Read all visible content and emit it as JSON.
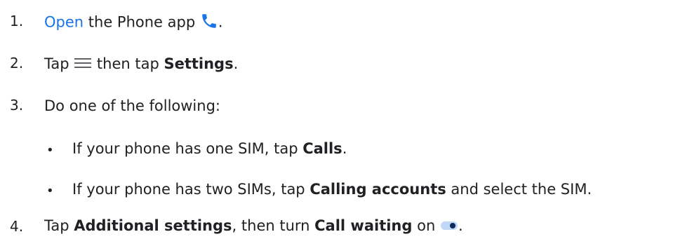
{
  "steps": [
    {
      "number": "1.",
      "link": "Open",
      "text_a": " the Phone app ",
      "icon": "phone-icon",
      "text_b": "."
    },
    {
      "number": "2.",
      "text_a": "Tap ",
      "icon": "menu-icon",
      "text_b": " then tap ",
      "bold": "Settings",
      "text_c": "."
    },
    {
      "number": "3.",
      "text_a": "Do one of the following:",
      "bullets": [
        {
          "text_a": "If your phone has one SIM, tap ",
          "bold": "Calls",
          "text_b": "."
        },
        {
          "text_a": "If your phone has two SIMs, tap ",
          "bold": "Calling accounts",
          "text_b": " and select the SIM."
        }
      ]
    },
    {
      "number": "4.",
      "text_a": "Tap ",
      "bold_a": "Additional settings",
      "text_b": ", then turn ",
      "bold_b": "Call waiting",
      "text_c": " on ",
      "icon": "toggle-on-icon",
      "text_d": "."
    }
  ],
  "colors": {
    "link": "#1a73e8",
    "phone_icon": "#1a73e8",
    "menu_icon": "#5f6368",
    "toggle_track": "#c2d6f7",
    "toggle_thumb": "#0b2b5c",
    "text": "#202124"
  }
}
